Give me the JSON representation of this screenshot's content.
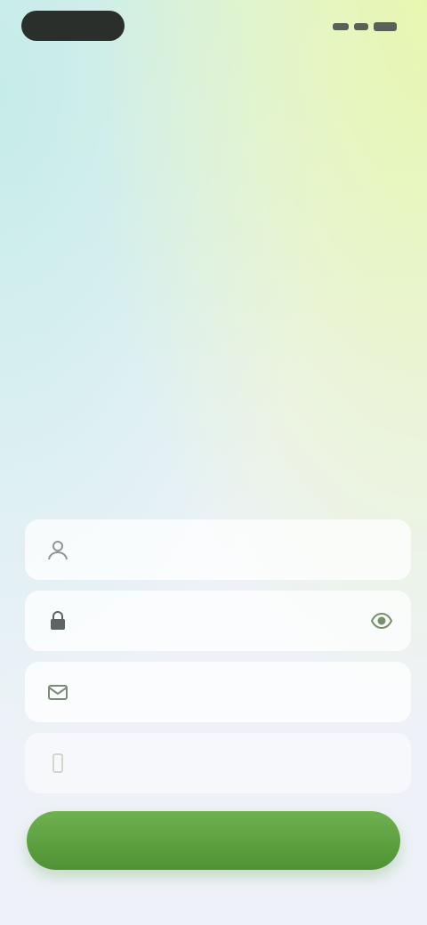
{
  "status_bar": {
    "pill_color": "#2a2f2c"
  },
  "headline": "",
  "form": {
    "fields": [
      {
        "icon": "user-icon",
        "placeholder": "",
        "value": ""
      },
      {
        "icon": "lock-icon",
        "placeholder": "",
        "value": ""
      },
      {
        "icon": "mail-icon",
        "placeholder": "",
        "value": ""
      },
      {
        "icon": "phone-icon",
        "placeholder": "",
        "value": ""
      }
    ]
  },
  "submit": {
    "label": "",
    "color": "#5fa442"
  }
}
